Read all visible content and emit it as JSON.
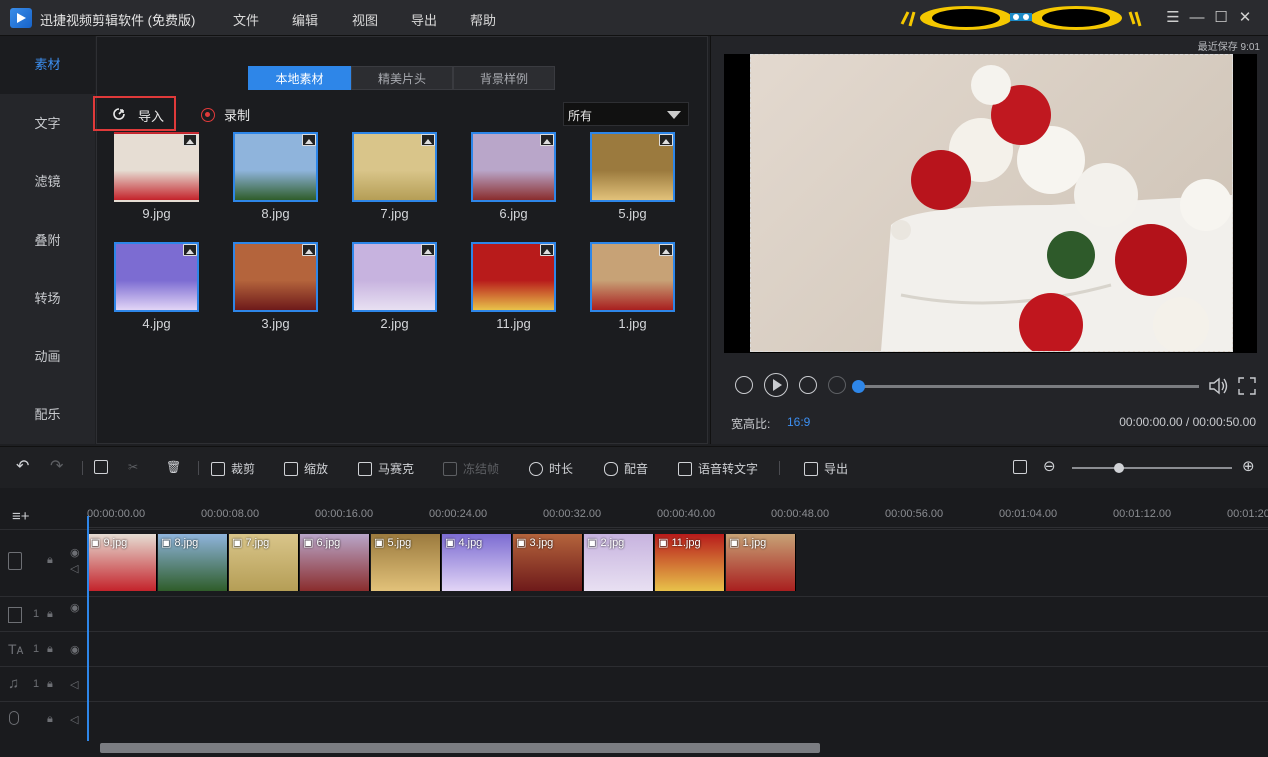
{
  "app": {
    "title": "迅捷视频剪辑软件 (免费版)",
    "menu": [
      "文件",
      "编辑",
      "视图",
      "导出",
      "帮助"
    ]
  },
  "window_controls": [
    "menu-icon",
    "minimize-icon",
    "maximize-icon",
    "close-icon"
  ],
  "leftnav": [
    "素材",
    "文字",
    "滤镜",
    "叠附",
    "转场",
    "动画",
    "配乐"
  ],
  "media": {
    "tabs": [
      "本地素材",
      "精美片头",
      "背景样例"
    ],
    "import_label": "导入",
    "record_label": "录制",
    "filter_value": "所有",
    "items": [
      {
        "name": "9.jpg",
        "color": "#e6ddd3",
        "accent": "#c4232b"
      },
      {
        "name": "8.jpg",
        "color": "#8fb4dc",
        "accent": "#2f5d2a"
      },
      {
        "name": "7.jpg",
        "color": "#d9c58a",
        "accent": "#b59e56"
      },
      {
        "name": "6.jpg",
        "color": "#b9a6c9",
        "accent": "#8a2d2d"
      },
      {
        "name": "5.jpg",
        "color": "#9b7a3e",
        "accent": "#e2c27a"
      },
      {
        "name": "4.jpg",
        "color": "#7c6cd2",
        "accent": "#e2d5f6"
      },
      {
        "name": "3.jpg",
        "color": "#b4643c",
        "accent": "#6e1a1a"
      },
      {
        "name": "2.jpg",
        "color": "#c7b3df",
        "accent": "#e8e0f2"
      },
      {
        "name": "11.jpg",
        "color": "#b81b1b",
        "accent": "#e8c24a"
      },
      {
        "name": "1.jpg",
        "color": "#c7a276",
        "accent": "#a91f1f"
      }
    ]
  },
  "preview": {
    "save_time": "最近保存 9:01",
    "aspect_label": "宽高比:",
    "aspect_value": "16:9",
    "time": "00:00:00.00 / 00:00:50.00",
    "progress": 0
  },
  "toolbar": {
    "crop": "裁剪",
    "zoom": "缩放",
    "mosaic": "马赛克",
    "freeze": "冻结帧",
    "duration": "时长",
    "dub": "配音",
    "speech": "语音转文字",
    "export": "导出"
  },
  "ruler": [
    "00:00:00.00",
    "00:00:08.00",
    "00:00:16.00",
    "00:00:24.00",
    "00:00:32.00",
    "00:00:40.00",
    "00:00:48.00",
    "00:00:56.00",
    "00:01:04.00",
    "00:01:12.00",
    "00:01:20"
  ],
  "clips": [
    "9.jpg",
    "8.jpg",
    "7.jpg",
    "6.jpg",
    "5.jpg",
    "4.jpg",
    "3.jpg",
    "2.jpg",
    "11.jpg",
    "1.jpg"
  ],
  "tracks": [
    "1",
    "1",
    "1"
  ]
}
